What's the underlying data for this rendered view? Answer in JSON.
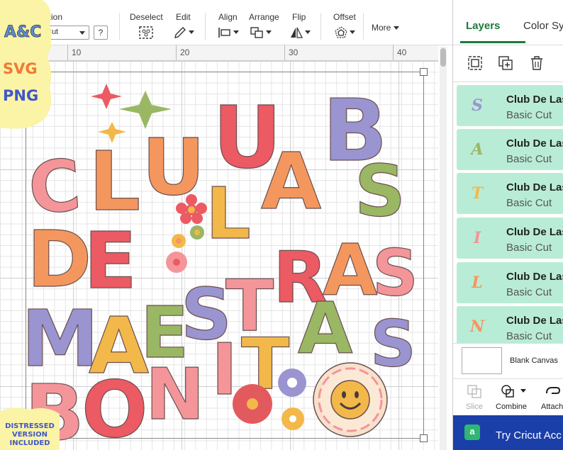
{
  "toolbar": {
    "operation_label": "ation",
    "operation_value": "Cut",
    "help": "?",
    "deselect_label": "Deselect",
    "edit_label": "Edit",
    "align_label": "Align",
    "arrange_label": "Arrange",
    "flip_label": "Flip",
    "offset_label": "Offset",
    "more_label": "More"
  },
  "ruler": {
    "marks": [
      "10",
      "20",
      "30",
      "40"
    ]
  },
  "design": {
    "title_lines": [
      "CLUB",
      "LAS",
      "DE",
      "MAESTRAS",
      "BONITAS"
    ],
    "colors": {
      "pink": "#f4959a",
      "red": "#ec5a63",
      "orange": "#f4975e",
      "yellow": "#f3b84a",
      "green": "#9ab764",
      "lavender": "#9a94d0",
      "accent_red": "#e35a5e"
    }
  },
  "panel": {
    "tabs": [
      "Layers",
      "Color Sy"
    ],
    "action_icons": [
      "group-icon",
      "duplicate-icon",
      "delete-icon"
    ],
    "layers": [
      {
        "glyph": "S",
        "glyph_color": "#9a94d0",
        "name": "Club De Las",
        "type": "Basic Cut"
      },
      {
        "glyph": "A",
        "glyph_color": "#9ab764",
        "name": "Club De Las",
        "type": "Basic Cut"
      },
      {
        "glyph": "T",
        "glyph_color": "#f3b84a",
        "name": "Club De Las",
        "type": "Basic Cut"
      },
      {
        "glyph": "I",
        "glyph_color": "#f4959a",
        "name": "Club De Las",
        "type": "Basic Cut"
      },
      {
        "glyph": "L",
        "glyph_color": "#f4975e",
        "name": "Club De Las",
        "type": "Basic Cut"
      },
      {
        "glyph": "N",
        "glyph_color": "#f4975e",
        "name": "Club De Las",
        "type": "Basic Cut"
      }
    ],
    "blank_canvas": "Blank Canvas",
    "bottom_tools": [
      {
        "label": "Slice",
        "disabled": true
      },
      {
        "label": "Combine",
        "disabled": false
      },
      {
        "label": "Attach",
        "disabled": false
      }
    ],
    "banner_icon": "a",
    "banner_text": "Try Cricut Acc"
  },
  "overlay": {
    "logo": "A&C",
    "formats": [
      "SVG",
      "PNG"
    ],
    "badge_lines": [
      "DISTRESSED",
      "VERSION",
      "INCLUDED"
    ]
  }
}
